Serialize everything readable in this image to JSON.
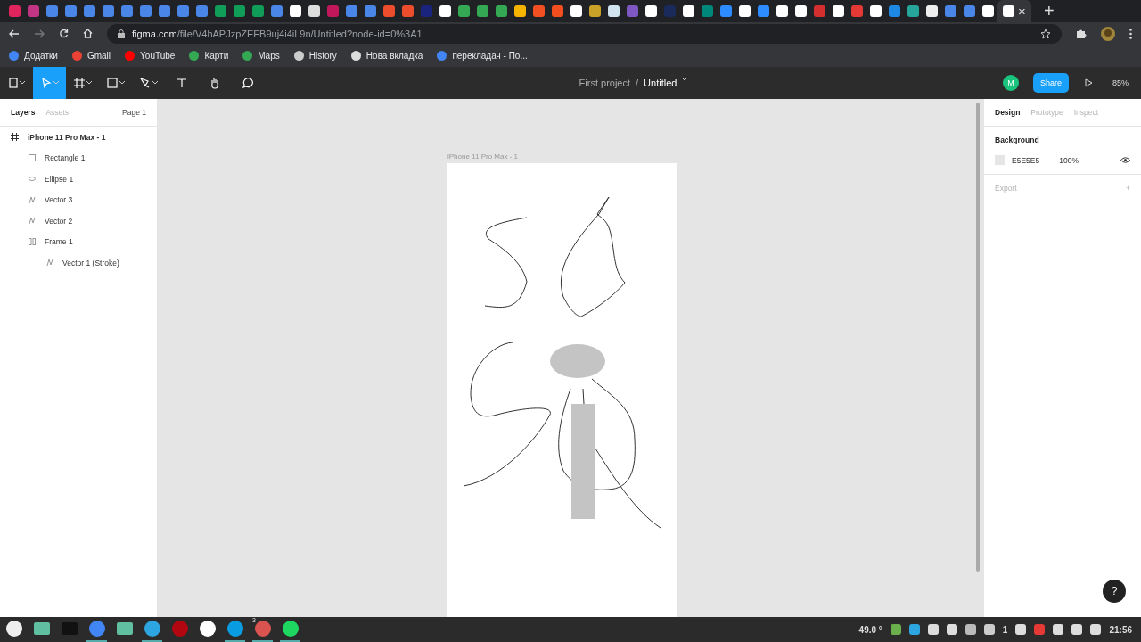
{
  "browser": {
    "tabs": [
      {
        "color": "#e0245e",
        "selected": false
      },
      {
        "color": "#c13584",
        "selected": false
      },
      {
        "color": "#4a86e8",
        "selected": false
      },
      {
        "color": "#4a86e8",
        "selected": false
      },
      {
        "color": "#4a86e8",
        "selected": false
      },
      {
        "color": "#4a86e8",
        "selected": false
      },
      {
        "color": "#4a86e8",
        "selected": false
      },
      {
        "color": "#4a86e8",
        "selected": false
      },
      {
        "color": "#4a86e8",
        "selected": false
      },
      {
        "color": "#4a86e8",
        "selected": false
      },
      {
        "color": "#4a86e8",
        "selected": false
      },
      {
        "color": "#0f9d58",
        "selected": false
      },
      {
        "color": "#0f9d58",
        "selected": false
      },
      {
        "color": "#0f9d58",
        "selected": false
      },
      {
        "color": "#4a86e8",
        "selected": false
      },
      {
        "color": "#ffffff",
        "selected": false
      },
      {
        "color": "#dddddd",
        "selected": false
      },
      {
        "color": "#c2185b",
        "selected": false
      },
      {
        "color": "#4a86e8",
        "selected": false
      },
      {
        "color": "#4a86e8",
        "selected": false
      },
      {
        "color": "#ee4d2d",
        "selected": false
      },
      {
        "color": "#ee4d2d",
        "selected": false
      },
      {
        "color": "#1a237e",
        "selected": false
      },
      {
        "color": "#ffffff",
        "selected": false
      },
      {
        "color": "#34a853",
        "selected": false
      },
      {
        "color": "#34a853",
        "selected": false
      },
      {
        "color": "#34a853",
        "selected": false
      },
      {
        "color": "#f4b400",
        "selected": false
      },
      {
        "color": "#f25022",
        "selected": false
      },
      {
        "color": "#f24e1e",
        "selected": false
      },
      {
        "color": "#ffffff",
        "selected": false
      },
      {
        "color": "#c9a227",
        "selected": false
      },
      {
        "color": "#d0e4f0",
        "selected": false
      },
      {
        "color": "#7e57c2",
        "selected": false
      },
      {
        "color": "#ffffff",
        "selected": false
      },
      {
        "color": "#1a2a5a",
        "selected": false
      },
      {
        "color": "#ffffff",
        "selected": false
      },
      {
        "color": "#00897b",
        "selected": false
      },
      {
        "color": "#2d8cff",
        "selected": false
      },
      {
        "color": "#ffffff",
        "selected": false
      },
      {
        "color": "#2d8cff",
        "selected": false
      },
      {
        "color": "#ffffff",
        "selected": false
      },
      {
        "color": "#ffffff",
        "selected": false
      },
      {
        "color": "#d32f2f",
        "selected": false
      },
      {
        "color": "#ffffff",
        "selected": false
      },
      {
        "color": "#e53935",
        "selected": false
      },
      {
        "color": "#ffffff",
        "selected": false
      },
      {
        "color": "#1e88e5",
        "selected": false
      },
      {
        "color": "#26a69a",
        "selected": false
      },
      {
        "color": "#eeeeee",
        "selected": false
      },
      {
        "color": "#4a86e8",
        "selected": false
      },
      {
        "color": "#4a86e8",
        "selected": false
      },
      {
        "color": "#ffffff",
        "selected": false
      },
      {
        "color": "#ffffff",
        "selected": true
      }
    ],
    "close_tab": "×",
    "new_tab": "+",
    "url_host": "figma.com",
    "url_path": "/file/V4hAPJzpZEFB9uj4i4iL9n/Untitled?node-id=0%3A1",
    "bookmarks": [
      {
        "label": "Додатки",
        "color": "#4285f4"
      },
      {
        "label": "Gmail",
        "color": "#ea4335"
      },
      {
        "label": "YouTube",
        "color": "#ff0000"
      },
      {
        "label": "Карти",
        "color": "#34a853"
      },
      {
        "label": "Maps",
        "color": "#34a853"
      },
      {
        "label": "History",
        "color": "#cccccc"
      },
      {
        "label": "Нова вкладка",
        "color": "#dddddd"
      },
      {
        "label": "перекладач - По...",
        "color": "#4285f4"
      }
    ]
  },
  "figma": {
    "tools": [
      {
        "kind": "menu",
        "selected": false
      },
      {
        "kind": "move",
        "selected": true
      },
      {
        "kind": "frame",
        "selected": false
      },
      {
        "kind": "shape",
        "selected": false
      },
      {
        "kind": "pen",
        "selected": false
      },
      {
        "kind": "text",
        "selected": false
      },
      {
        "kind": "hand",
        "selected": false
      },
      {
        "kind": "comment",
        "selected": false
      }
    ],
    "project": "First project",
    "separator": "/",
    "file": "Untitled",
    "avatar": "M",
    "share": "Share",
    "zoom": "85%",
    "left_tabs": [
      {
        "label": "Layers",
        "selected": true
      },
      {
        "label": "Assets",
        "selected": false
      }
    ],
    "page": "Page 1",
    "layers": [
      {
        "kind": "frame",
        "name": "iPhone 11 Pro Max - 1",
        "children": [
          {
            "kind": "rectangle",
            "name": "Rectangle 1"
          },
          {
            "kind": "ellipse",
            "name": "Ellipse 1"
          },
          {
            "kind": "vector",
            "name": "Vector 3"
          },
          {
            "kind": "vector",
            "name": "Vector 2"
          },
          {
            "kind": "group",
            "name": "Frame 1",
            "children": [
              {
                "kind": "vector",
                "name": "Vector 1 (Stroke)"
              }
            ]
          }
        ]
      }
    ],
    "frame_label": "iPhone 11 Pro Max - 1",
    "right_tabs": [
      {
        "label": "Design",
        "selected": true
      },
      {
        "label": "Prototype",
        "selected": false
      },
      {
        "label": "Inspect",
        "selected": false
      }
    ],
    "background": {
      "title": "Background",
      "color": "#e5e5e5",
      "hex": "E5E5E5",
      "opacity": "100%"
    },
    "export": {
      "title": "Export",
      "add": "+"
    },
    "help": "?"
  },
  "taskbar": {
    "apps": [
      {
        "kind": "mint",
        "running": false
      },
      {
        "kind": "folder",
        "running": false
      },
      {
        "kind": "terminal",
        "running": false
      },
      {
        "kind": "chrome",
        "running": true
      },
      {
        "kind": "folder",
        "running": false
      },
      {
        "kind": "telegram",
        "running": true
      },
      {
        "kind": "netflix",
        "running": false
      },
      {
        "kind": "instagram",
        "running": false
      },
      {
        "kind": "skype",
        "running": true
      },
      {
        "kind": "glasses",
        "running": true,
        "badge": "3"
      },
      {
        "kind": "spotify",
        "running": true
      }
    ],
    "temperature": "49.0 °",
    "notifications": "1",
    "clock": "21:56"
  }
}
